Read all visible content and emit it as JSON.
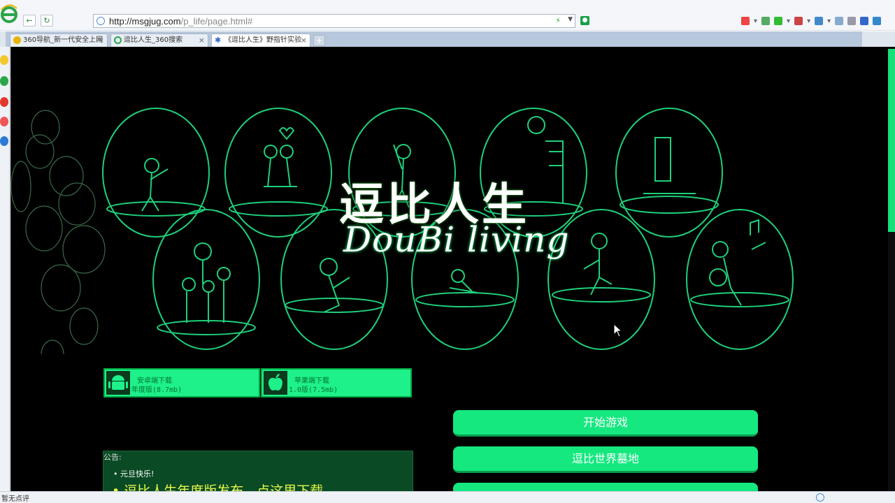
{
  "browser": {
    "url_host": "http://msgjug.com",
    "url_path": "/p_life/page.html#",
    "tabs": [
      {
        "label": "360导航_新一代安全上网"
      },
      {
        "label": "逗比人生_360搜索"
      },
      {
        "label": "《逗比人生》野指针实验"
      }
    ],
    "status_text": "暂无点评"
  },
  "page": {
    "logo_cn": "逗比人生",
    "logo_en": "DouBi living",
    "downloads": [
      {
        "line1": "安卓端下载",
        "line2": "年度版(8.7mb)"
      },
      {
        "line1": "苹果端下载",
        "line2": "1.0版(7.5mb)"
      }
    ],
    "notice": {
      "title": "公告:",
      "item1": "元旦快乐!",
      "item2": "逗比人生年度版发布，点这里下载"
    },
    "menu": [
      {
        "label": "开始游戏"
      },
      {
        "label": "逗比世界墓地"
      }
    ],
    "colors": {
      "accent": "#14e87e",
      "bg": "#000000",
      "line": "#1fcf7a"
    }
  }
}
